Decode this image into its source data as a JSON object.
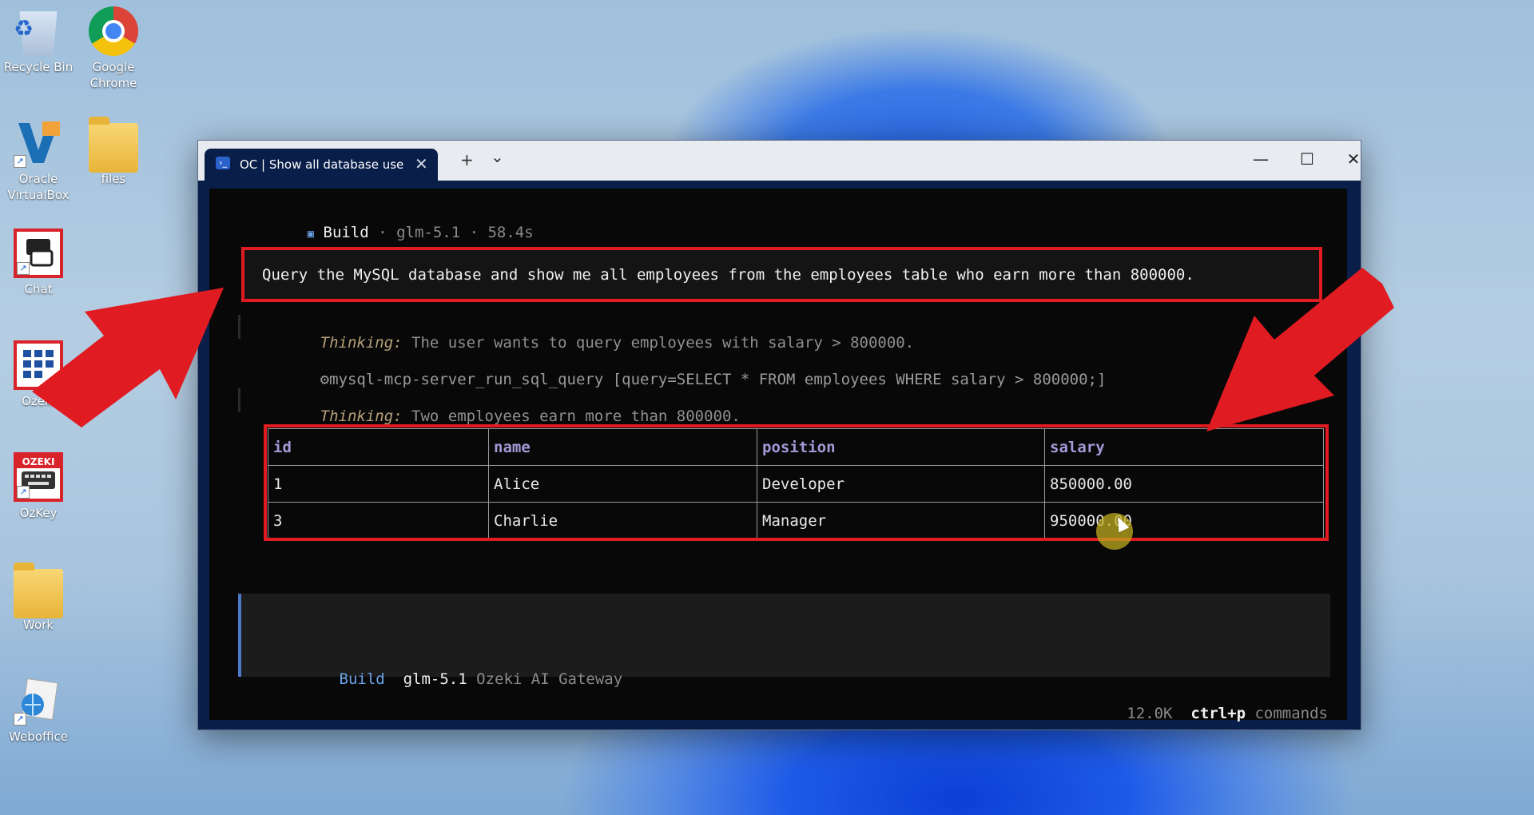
{
  "desktop": {
    "icons": [
      {
        "label": "Recycle Bin",
        "icon": "recycle-bin-icon"
      },
      {
        "label": "Google\nChrome",
        "icon": "chrome-icon"
      },
      {
        "label": "Oracle\nVirtualBox",
        "icon": "virtualbox-icon"
      },
      {
        "label": "files",
        "icon": "folder-icon"
      },
      {
        "label": "Chat",
        "icon": "chat-icon"
      },
      {
        "label": "Ozeki",
        "icon": "ozeki-icon"
      },
      {
        "label": "OzKey",
        "icon": "ozkey-icon"
      },
      {
        "label": "Work",
        "icon": "folder-icon"
      },
      {
        "label": "Weboffice",
        "icon": "weboffice-icon"
      }
    ],
    "ozkey_badge": "OZEKI"
  },
  "window": {
    "tab_title": "OC | Show all database user",
    "tab_icon": "powershell-icon",
    "new_tab": "+",
    "dropdown": "⌄",
    "minimize": "—",
    "maximize": "☐",
    "close": "✕"
  },
  "terminal": {
    "header": {
      "bullet": "▣",
      "agent": "Build",
      "separator1": " · ",
      "model": "glm-5.1",
      "separator2": " · ",
      "duration": "58.4s"
    },
    "prompt": "Query the MySQL database and show me all employees from the employees table who earn more than 800000.",
    "thinking1_key": "Thinking:",
    "thinking1_text": " The user wants to query employees with salary > 800000.",
    "tool_icon": "⚙",
    "tool_call": "mysql-mcp-server_run_sql_query [query=SELECT * FROM employees WHERE salary > 800000;]",
    "thinking2_key": "Thinking:",
    "thinking2_text": " Two employees earn more than 800000.",
    "table": {
      "headers": [
        "id",
        "name",
        "position",
        "salary"
      ],
      "rows": [
        [
          "1",
          "Alice",
          "Developer",
          "850000.00"
        ],
        [
          "3",
          "Charlie",
          "Manager",
          "950000.00"
        ]
      ]
    },
    "input_status": {
      "agent": "Build",
      "model": "glm-5.1",
      "provider": "Ozeki AI Gateway"
    },
    "footer": {
      "tokens": "12.0K",
      "shortcut": "ctrl+p",
      "shortcut_label": "commands"
    }
  },
  "colors": {
    "highlight_red": "#e01b22",
    "agent_blue": "#6aa3e8",
    "table_header": "#a39bd8"
  }
}
